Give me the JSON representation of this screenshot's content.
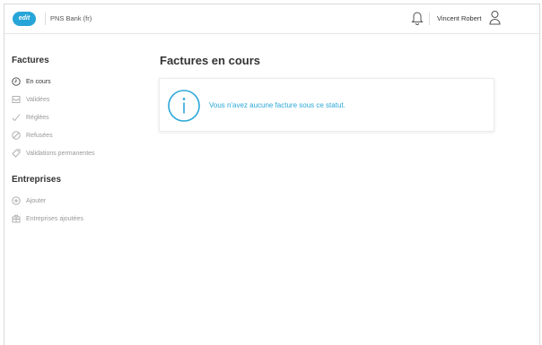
{
  "header": {
    "logo_text": "edit",
    "bank_name": "PNS Bank (fr)",
    "user_name": "Vincent Robert",
    "icons": [
      "bell-icon",
      "user-icon"
    ]
  },
  "sidebar": {
    "factures_title": "Factures",
    "factures_items": [
      {
        "label": "En cours",
        "icon": "clock-icon",
        "active": true
      },
      {
        "label": "Validées",
        "icon": "inbox-icon",
        "active": false
      },
      {
        "label": "Réglées",
        "icon": "check-icon",
        "active": false
      },
      {
        "label": "Refusées",
        "icon": "cancel-icon",
        "active": false
      },
      {
        "label": "Validations permanentes",
        "icon": "tag-icon",
        "active": false
      }
    ],
    "entreprises_title": "Entreprises",
    "entreprises_items": [
      {
        "label": "Ajouter",
        "icon": "plus-circle-icon",
        "active": false
      },
      {
        "label": "Entreprises ajoutées",
        "icon": "building-icon",
        "active": false
      }
    ]
  },
  "main": {
    "title": "Factures en cours",
    "empty_message": "Vous n'avez aucune facture sous ce statut."
  },
  "colors": {
    "accent": "#2aa7d8",
    "logo": "#27a5d8",
    "text": "#333333",
    "muted": "#999999"
  }
}
